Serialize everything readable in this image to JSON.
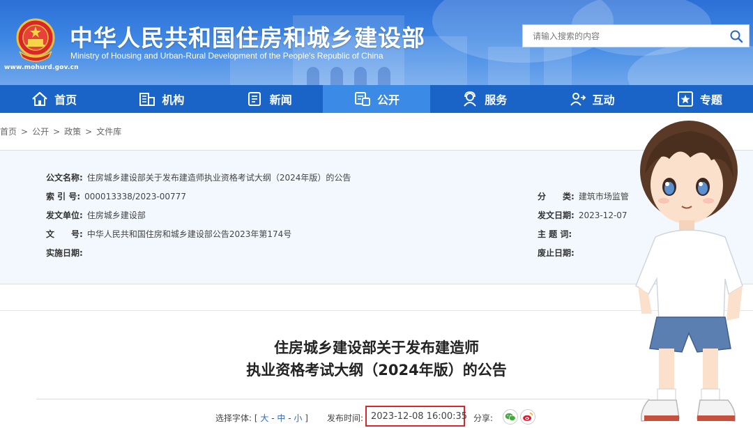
{
  "header": {
    "title": "中华人民共和国住房和城乡建设部",
    "subtitle": "Ministry of Housing and Urban-Rural Development of the People's Republic of China",
    "url": "www.mohurd.gov.cn",
    "emblem_icon": "national-emblem-icon"
  },
  "search": {
    "placeholder": "请输入搜索的内容",
    "icon": "search-icon"
  },
  "nav": {
    "items": [
      {
        "label": "首页",
        "icon": "home-icon"
      },
      {
        "label": "机构",
        "icon": "building-icon"
      },
      {
        "label": "新闻",
        "icon": "news-icon"
      },
      {
        "label": "公开",
        "icon": "document-icon",
        "active": true
      },
      {
        "label": "服务",
        "icon": "service-person-icon"
      },
      {
        "label": "互动",
        "icon": "interaction-icon"
      },
      {
        "label": "专题",
        "icon": "star-icon"
      }
    ]
  },
  "breadcrumb": [
    "首页",
    "公开",
    "政策",
    "文件库"
  ],
  "meta": {
    "doc_name_label": "公文名称:",
    "doc_name": "住房城乡建设部关于发布建造师执业资格考试大纲（2024年版）的公告",
    "index_label": "索 引 号:",
    "index": "000013338/2023-00777",
    "issuer_label": "发文单位:",
    "issuer": "住房城乡建设部",
    "doc_no_label": "文　　号:",
    "doc_no": "中华人民共和国住房和城乡建设部公告2023年第174号",
    "effective_label": "实施日期:",
    "effective": "",
    "category_label": "分　　类:",
    "category": "建筑市场监管",
    "issue_date_label": "发文日期:",
    "issue_date": "2023-12-07",
    "subject_label": "主 题 词:",
    "subject": "",
    "expiry_label": "废止日期:",
    "expiry": ""
  },
  "article": {
    "title_line1": "住房城乡建设部关于发布建造师",
    "title_line2": "执业资格考试大纲（2024年版）的公告",
    "font_label": "选择字体:",
    "font_open": "[",
    "font_large": "大",
    "font_medium": "中",
    "font_small": "小",
    "font_close": "]",
    "font_dash": "-",
    "publish_label": "发布时间:",
    "publish_time": "2023-12-08 16:00:35",
    "share_label": "分享:"
  },
  "colors": {
    "banner": "#2c6fd6",
    "nav": "#1a64c8",
    "nav_active": "#3a8ae6",
    "highlight_box": "#d8262b",
    "meta_bg": "#f2f8fd"
  }
}
